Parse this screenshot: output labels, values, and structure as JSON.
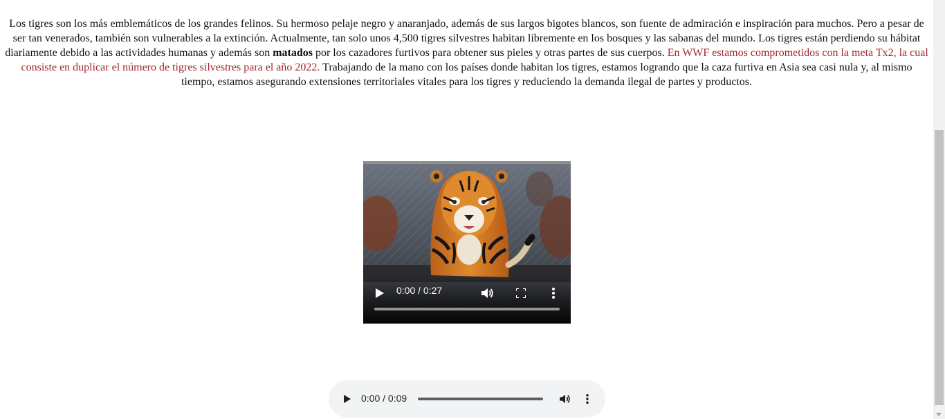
{
  "article": {
    "text_part1": "Los tigres son los más emblemáticos de los grandes felinos. Su hermoso pelaje negro y anaranjado, además de sus largos bigotes blancos, son fuente de admiración e inspiración para muchos. Pero a pesar de ser tan venerados, también son vulnerables a la extinción. Actualmente, tan solo unos 4,500 tigres silvestres habitan libremente en los bosques y las sabanas del mundo. Los tigres están perdiendo su hábitat diariamente debido a las actividades humanas y además son ",
    "bold_word": "matados",
    "text_part2": " por los cazadores furtivos para obtener sus pieles y otras partes de sus cuerpos. ",
    "highlight_text": "En WWF estamos comprometidos con la meta Tx2, la cual consiste en duplicar el número de tigres silvestres para el año 2022.",
    "text_part3": " Trabajando de la mano con los países donde habitan los tigres, estamos logrando que la caza furtiva en Asia sea casi nula y, al mismo tiempo, estamos asegurando extensiones territoriales vitales para los tigres y reduciendo la demanda ilegal de partes y productos.",
    "highlight_color": "#a3262b"
  },
  "video_player": {
    "time_display": "0:00 / 0:27",
    "progress": 0,
    "icons": [
      "play-icon",
      "volume-icon",
      "fullscreen-icon",
      "more-options-icon"
    ]
  },
  "audio_player": {
    "time_display": "0:00 / 0:09",
    "progress": 0,
    "background_color": "#f1f3f4",
    "icons": [
      "play-icon",
      "volume-icon",
      "more-options-icon"
    ]
  }
}
